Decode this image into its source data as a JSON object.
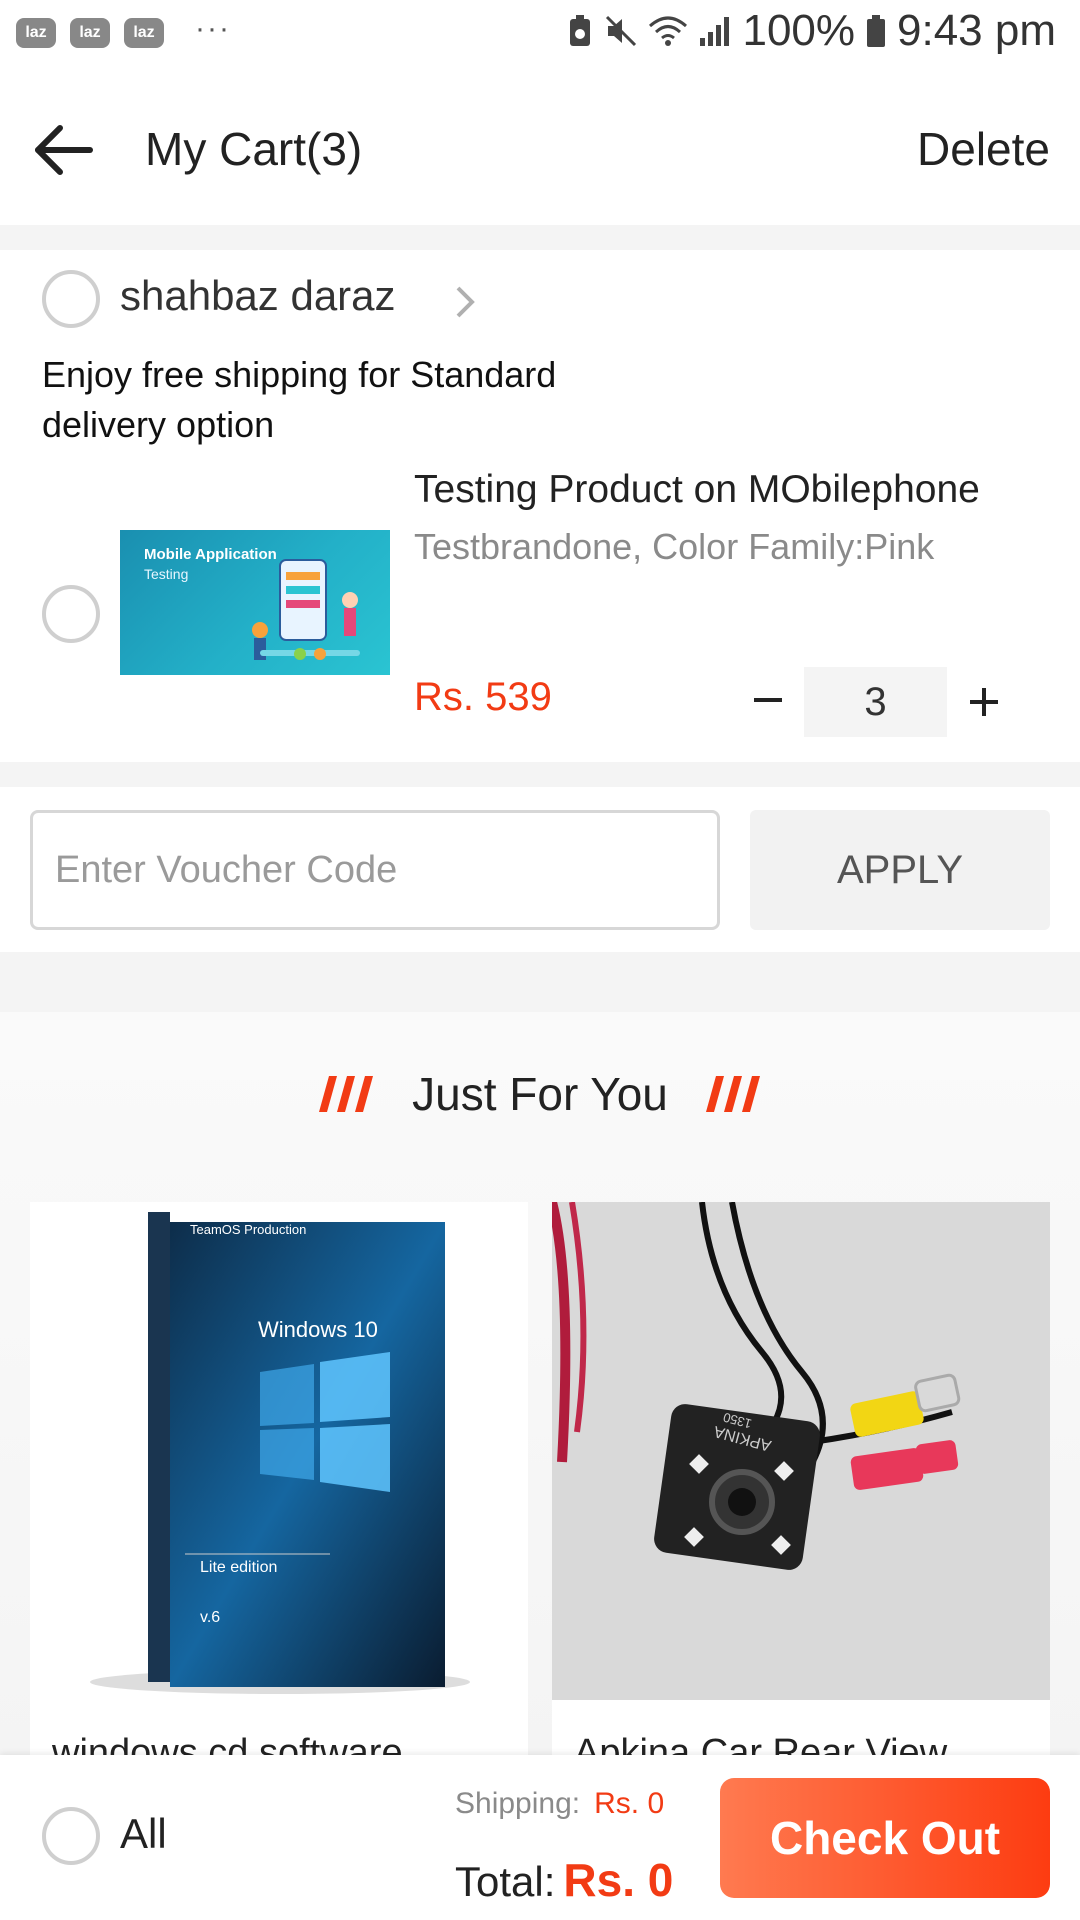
{
  "status_bar": {
    "notification_icons": [
      "laz",
      "laz",
      "laz"
    ],
    "more_label": "···",
    "battery": "100%",
    "time": "9:43 pm"
  },
  "header": {
    "title": "My Cart(3)",
    "delete_label": "Delete"
  },
  "shop": {
    "name": "shahbaz daraz",
    "promo": "Enjoy free shipping for Standard delivery option"
  },
  "cart_item": {
    "image_title": "Mobile Application",
    "image_subtitle": "Testing",
    "name": "Testing Product on MObilephone",
    "variant": "Testbrandone, Color Family:Pink",
    "price": "Rs. 539",
    "quantity": "3",
    "minus_label": "−",
    "plus_label": "+"
  },
  "voucher": {
    "placeholder": "Enter Voucher Code",
    "apply_label": "APPLY"
  },
  "just_for_you": {
    "title": "Just For You",
    "products": [
      {
        "name": "windows cd software",
        "image_lines": [
          "TeamOS Production",
          "Windows 10",
          "Lite edition",
          "v.6"
        ]
      },
      {
        "name": "Apkina Car Rear View",
        "image_lines": [
          "APKINA",
          "1350"
        ]
      }
    ]
  },
  "checkout_bar": {
    "all_label": "All",
    "shipping_label": "Shipping:",
    "shipping_value": "Rs. 0",
    "total_label": "Total:",
    "total_value": "Rs. 0",
    "checkout_label": "Check Out"
  },
  "colors": {
    "accent": "#f23b14",
    "checkout_gradient_start": "#ff7a50",
    "checkout_gradient_end": "#fd3c11"
  }
}
